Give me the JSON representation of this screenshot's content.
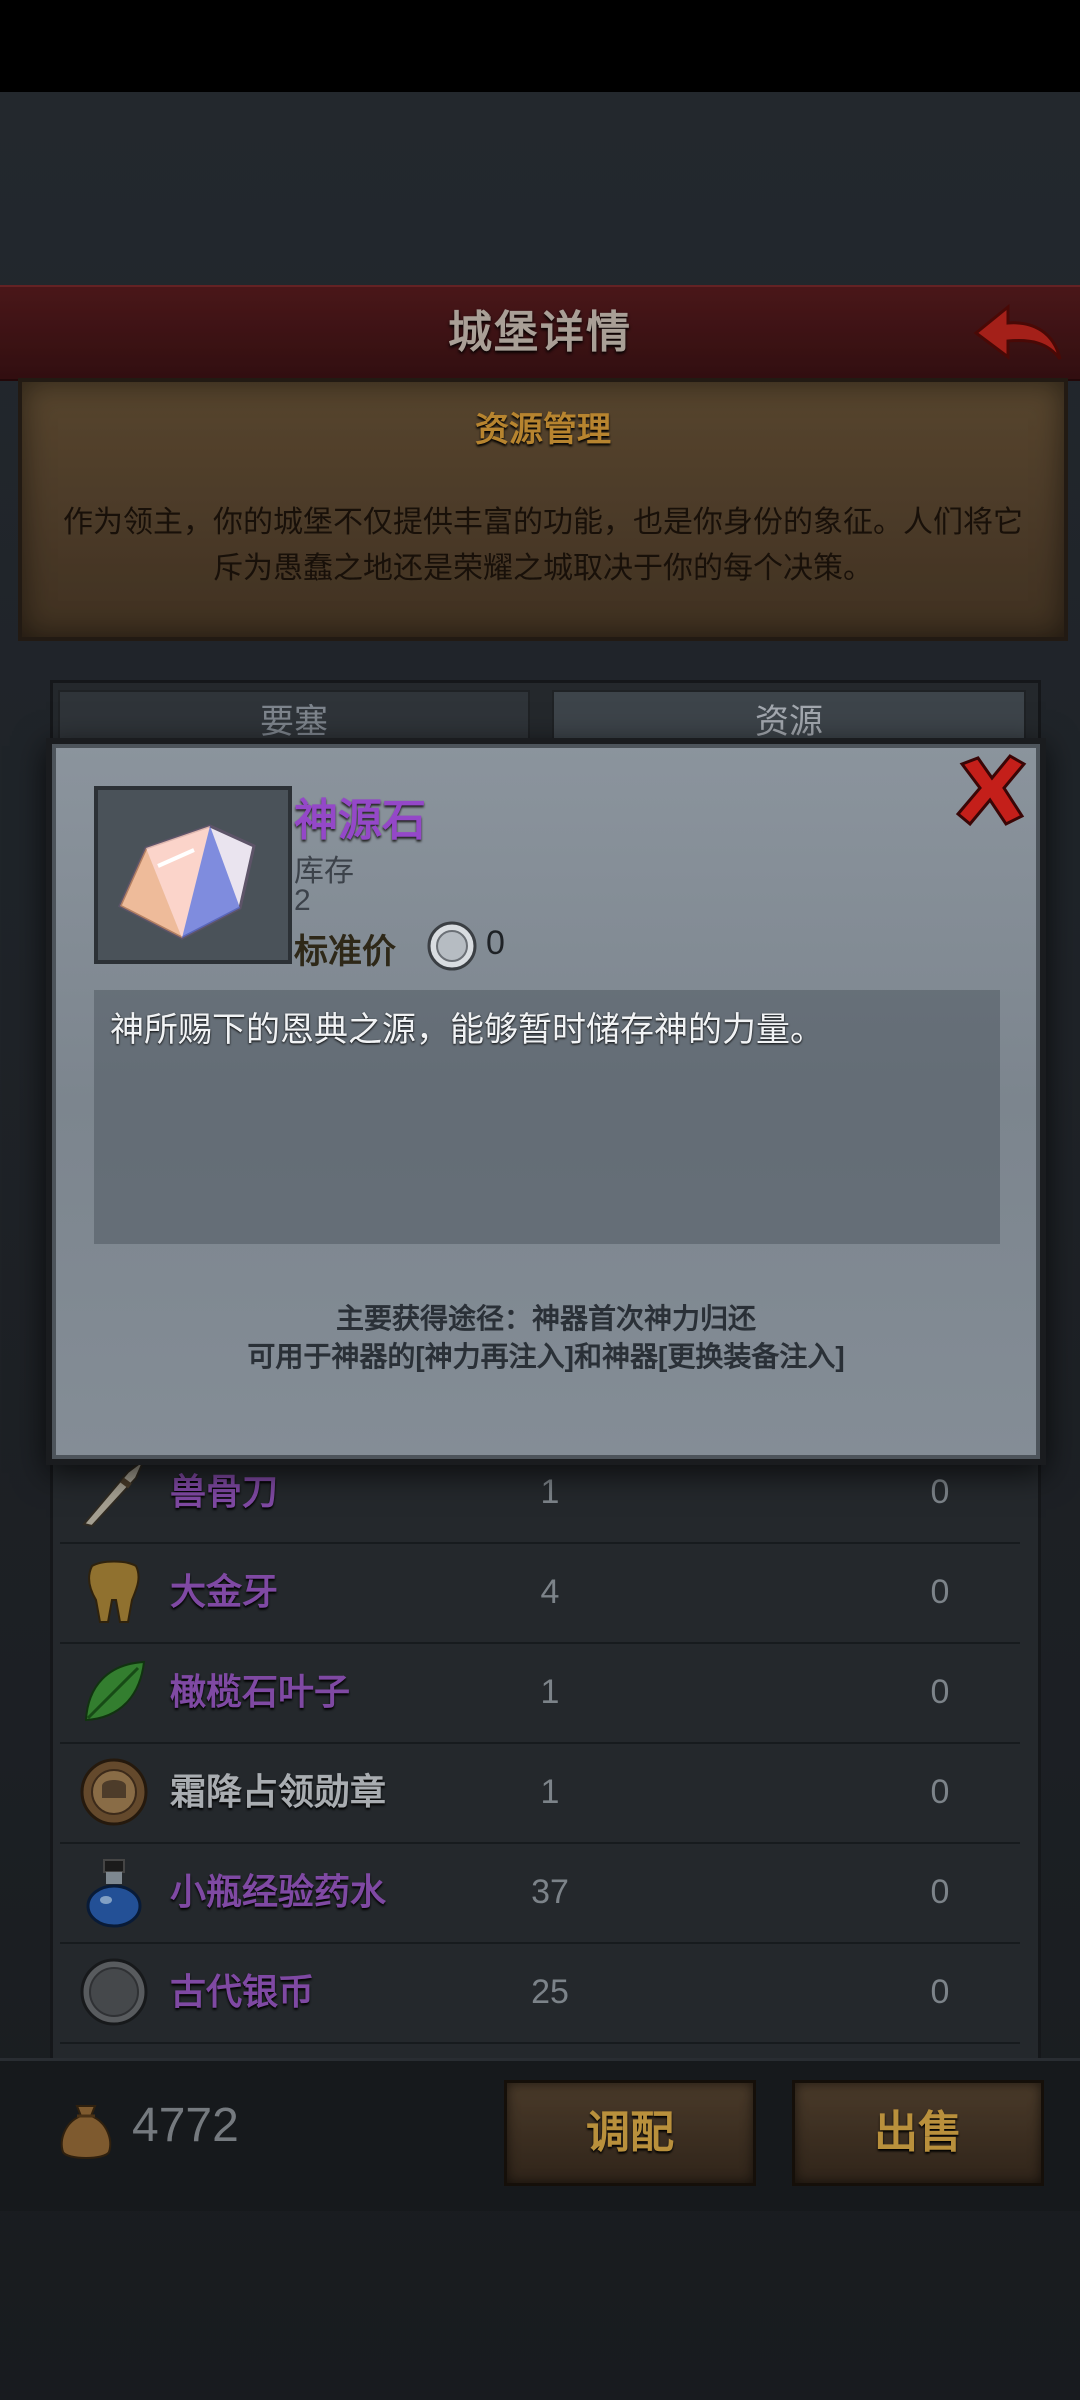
{
  "header": {
    "title": "城堡详情"
  },
  "intro": {
    "title": "资源管理",
    "text": "作为领主，你的城堡不仅提供丰富的功能，也是你身份的象征。人们将它斥为愚蠢之地还是荣耀之城取决于你的每个决策。"
  },
  "tabs": [
    {
      "label": "要塞"
    },
    {
      "label": "资源"
    }
  ],
  "items": [
    {
      "name": "兽骨刀",
      "qty": "1",
      "value": "0",
      "icon": "bone-knife-icon",
      "color": "purple"
    },
    {
      "name": "大金牙",
      "qty": "4",
      "value": "0",
      "icon": "gold-tooth-icon",
      "color": "purple"
    },
    {
      "name": "橄榄石叶子",
      "qty": "1",
      "value": "0",
      "icon": "olive-leaf-icon",
      "color": "purple"
    },
    {
      "name": "霜降占领勋章",
      "qty": "1",
      "value": "0",
      "icon": "medal-icon",
      "color": "white"
    },
    {
      "name": "小瓶经验药水",
      "qty": "37",
      "value": "0",
      "icon": "potion-icon",
      "color": "purple"
    },
    {
      "name": "古代银币",
      "qty": "25",
      "value": "0",
      "icon": "silver-coin-icon",
      "color": "purple"
    }
  ],
  "footer": {
    "coins": "4772",
    "mix_label": "调配",
    "sell_label": "出售"
  },
  "popup": {
    "item_name": "神源石",
    "stock_label": "库存",
    "stock_value": "2",
    "price_label": "标准价",
    "price_value": "0",
    "description": "神所赐下的恩典之源，能够暂时储存神的力量。",
    "source_line1": "主要获得途径：神器首次神力归还",
    "source_line2": "可用于神器的[神力再注入]和神器[更换装备注入]"
  },
  "colors": {
    "item_purple": "#9b59c7",
    "header_red": "#5a1c1f",
    "gold_text": "#e2b04a"
  }
}
